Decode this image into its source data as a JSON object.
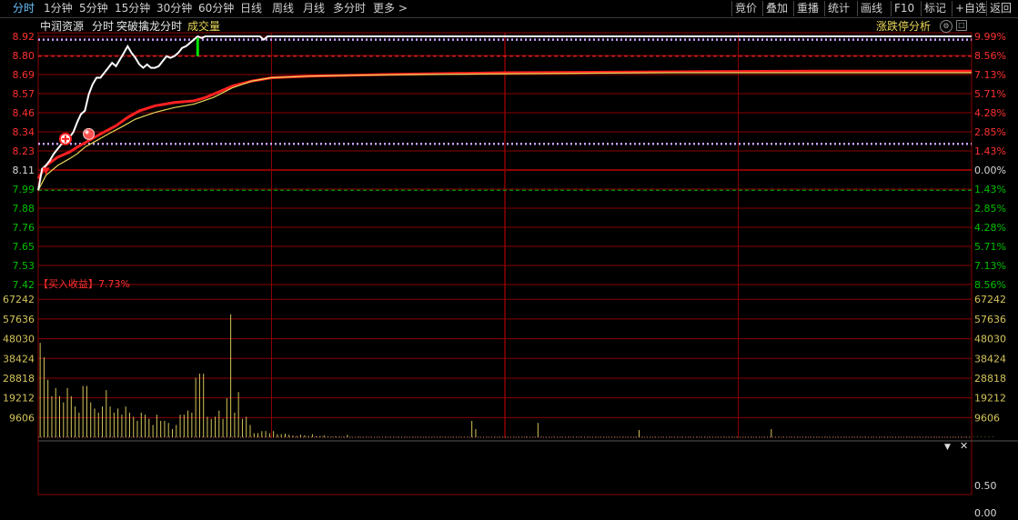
{
  "topbar": {
    "tabs": [
      "分时",
      "1分钟",
      "5分钟",
      "15分钟",
      "30分钟",
      "60分钟",
      "日线",
      "周线",
      "月线",
      "多分时",
      "更多 >"
    ],
    "active_tab": 0,
    "right_buttons": [
      "竟价",
      "叠加",
      "重播",
      "统计",
      "画线",
      "F10",
      "标记",
      "+自选",
      "返回"
    ]
  },
  "header": {
    "stock_name": "中润资源",
    "chart_mode": "分时",
    "indicator_name": "突破擒龙分时",
    "volume_label": "成交量",
    "limit_analysis": "涨跌停分析",
    "buy_profit_label": "【买入收益】",
    "buy_profit_value": "7.73%"
  },
  "colors": {
    "background": "#000000",
    "up": "#ff3030",
    "down": "#00c000",
    "price_line": "#ffffff",
    "avg_line": "#e8d858",
    "grid": "#8b0000",
    "volume_bar": "#d4c45a",
    "accent_label": "#6cc6ff"
  },
  "chart_data": {
    "type": "line",
    "price_axis": {
      "ticks": [
        "8.92",
        "8.80",
        "8.69",
        "8.57",
        "8.46",
        "8.34",
        "8.23",
        "8.11",
        "7.99",
        "7.88",
        "7.76",
        "7.65",
        "7.53",
        "7.42"
      ],
      "up_ticks": [
        "8.92",
        "8.80",
        "8.69",
        "8.57",
        "8.46",
        "8.34",
        "8.23"
      ],
      "base_tick": "8.11",
      "down_ticks": [
        "7.99",
        "7.88",
        "7.76",
        "7.65",
        "7.53",
        "7.42"
      ],
      "ylim": [
        7.42,
        8.92
      ],
      "pct_ticks": [
        "9.99%",
        "8.56%",
        "7.13%",
        "5.71%",
        "4.28%",
        "2.85%",
        "1.43%",
        "0.00%",
        "1.43%",
        "2.85%",
        "4.28%",
        "5.71%",
        "7.13%",
        "8.56%"
      ],
      "prev_close": 8.11
    },
    "reference_lines": [
      {
        "value": 8.9,
        "style": "dotted",
        "color": "#c8a0ff"
      },
      {
        "value": 8.8,
        "style": "dashed",
        "color": "#ff3030"
      },
      {
        "value": 8.27,
        "style": "dotted",
        "color": "#c8a0ff"
      },
      {
        "value": 7.99,
        "style": "dashed",
        "color": "#00c000"
      }
    ],
    "price_series": {
      "name": "",
      "points": [
        [
          0,
          7.99
        ],
        [
          1,
          8.12
        ],
        [
          2,
          8.14
        ],
        [
          3,
          8.17
        ],
        [
          4,
          8.21
        ],
        [
          5,
          8.24
        ],
        [
          6,
          8.27
        ],
        [
          7,
          8.29
        ],
        [
          8,
          8.31
        ],
        [
          9,
          8.34
        ],
        [
          10,
          8.4
        ],
        [
          11,
          8.45
        ],
        [
          12,
          8.47
        ],
        [
          13,
          8.57
        ],
        [
          14,
          8.63
        ],
        [
          15,
          8.67
        ],
        [
          16,
          8.67
        ],
        [
          17,
          8.7
        ],
        [
          18,
          8.73
        ],
        [
          19,
          8.76
        ],
        [
          20,
          8.74
        ],
        [
          21,
          8.78
        ],
        [
          22,
          8.82
        ],
        [
          23,
          8.86
        ],
        [
          24,
          8.82
        ],
        [
          25,
          8.79
        ],
        [
          26,
          8.75
        ],
        [
          27,
          8.73
        ],
        [
          28,
          8.75
        ],
        [
          29,
          8.73
        ],
        [
          30,
          8.73
        ],
        [
          31,
          8.74
        ],
        [
          32,
          8.77
        ],
        [
          33,
          8.8
        ],
        [
          34,
          8.79
        ],
        [
          35,
          8.8
        ],
        [
          36,
          8.82
        ],
        [
          37,
          8.85
        ],
        [
          38,
          8.86
        ],
        [
          39,
          8.88
        ],
        [
          40,
          8.9
        ],
        [
          41,
          8.92
        ],
        [
          42,
          8.91
        ],
        [
          43,
          8.92
        ],
        [
          45,
          8.92
        ],
        [
          50,
          8.92
        ],
        [
          55,
          8.92
        ],
        [
          57,
          8.92
        ],
        [
          58,
          8.9
        ],
        [
          59,
          8.92
        ],
        [
          61,
          8.92
        ],
        [
          65,
          8.92
        ],
        [
          100,
          8.92
        ],
        [
          150,
          8.92
        ],
        [
          200,
          8.92
        ],
        [
          240,
          8.92
        ]
      ]
    },
    "avg_series": {
      "name": "",
      "points": [
        [
          0,
          7.99
        ],
        [
          2,
          8.08
        ],
        [
          5,
          8.14
        ],
        [
          8,
          8.18
        ],
        [
          10,
          8.21
        ],
        [
          12,
          8.25
        ],
        [
          15,
          8.29
        ],
        [
          18,
          8.33
        ],
        [
          22,
          8.38
        ],
        [
          25,
          8.42
        ],
        [
          30,
          8.46
        ],
        [
          35,
          8.49
        ],
        [
          40,
          8.51
        ],
        [
          45,
          8.55
        ],
        [
          50,
          8.61
        ],
        [
          55,
          8.65
        ],
        [
          60,
          8.67
        ],
        [
          70,
          8.68
        ],
        [
          80,
          8.685
        ],
        [
          100,
          8.69
        ],
        [
          130,
          8.695
        ],
        [
          160,
          8.7
        ],
        [
          200,
          8.7
        ],
        [
          240,
          8.7
        ]
      ]
    },
    "indicator_series": {
      "name": "",
      "points": [
        [
          0,
          8.06
        ],
        [
          2,
          8.14
        ],
        [
          5,
          8.19
        ],
        [
          8,
          8.22
        ],
        [
          10,
          8.25
        ],
        [
          13,
          8.29
        ],
        [
          16,
          8.33
        ],
        [
          20,
          8.38
        ],
        [
          23,
          8.43
        ],
        [
          26,
          8.47
        ],
        [
          30,
          8.5
        ],
        [
          35,
          8.52
        ],
        [
          40,
          8.53
        ],
        [
          43,
          8.55
        ],
        [
          47,
          8.59
        ],
        [
          50,
          8.62
        ],
        [
          55,
          8.65
        ],
        [
          60,
          8.67
        ],
        [
          70,
          8.68
        ],
        [
          90,
          8.69
        ],
        [
          120,
          8.7
        ],
        [
          160,
          8.705
        ],
        [
          200,
          8.71
        ],
        [
          240,
          8.71
        ]
      ]
    },
    "markers": [
      {
        "x": 7,
        "y": 8.3,
        "kind": "buy-cross"
      },
      {
        "x": 13,
        "y": 8.33,
        "kind": "ball"
      },
      {
        "x": 2,
        "y": 8.11,
        "kind": "down-triangle"
      }
    ],
    "green_tick": {
      "x": 41,
      "value_top": 8.91,
      "value_bottom": 8.8
    },
    "volume_axis": {
      "ticks": [
        "67242",
        "57636",
        "48030",
        "38424",
        "28818",
        "19212",
        "9606"
      ],
      "ylim": [
        0,
        70000
      ]
    },
    "volume": [
      46000,
      39000,
      28000,
      20000,
      24000,
      20000,
      17000,
      24000,
      20000,
      15000,
      12000,
      25000,
      25000,
      17000,
      14000,
      12000,
      15000,
      23000,
      15000,
      12000,
      14000,
      11000,
      15000,
      12000,
      10000,
      8000,
      12000,
      11000,
      9000,
      6000,
      11000,
      8000,
      8000,
      7000,
      4000,
      6000,
      11000,
      11000,
      13000,
      12000,
      29000,
      31000,
      31000,
      10000,
      9000,
      10000,
      13000,
      9000,
      19000,
      60000,
      12000,
      22000,
      9000,
      10000,
      6000,
      2000,
      2000,
      3000,
      3000,
      2000,
      3000,
      1500,
      1500,
      1800,
      1200,
      800,
      600,
      1200,
      900,
      600,
      1500,
      500,
      600,
      900,
      400,
      300,
      500,
      300,
      300,
      1200,
      200,
      200,
      300,
      200,
      200,
      200,
      200,
      200,
      200,
      200,
      200,
      200,
      200,
      200,
      200,
      200,
      200,
      200,
      200,
      200,
      200,
      200,
      200,
      200,
      200,
      200,
      200,
      200,
      200,
      200,
      200,
      8000,
      4000,
      200,
      200,
      200,
      200,
      200,
      200,
      200,
      200,
      200,
      200,
      200,
      200,
      300,
      200,
      200,
      7000,
      200,
      200,
      200,
      200,
      200,
      200,
      200,
      200,
      200,
      200,
      200,
      200,
      200,
      200,
      200,
      200,
      200,
      200,
      200,
      200,
      200,
      200,
      200,
      200,
      200,
      3500,
      200,
      200,
      200,
      200,
      200,
      200,
      200,
      200,
      200,
      200,
      200,
      200,
      200,
      200,
      200,
      200,
      200,
      200,
      200,
      200,
      200,
      200,
      200,
      200,
      200,
      200,
      200,
      200,
      200,
      200,
      200,
      200,
      200,
      4000,
      200,
      200,
      200,
      200,
      200,
      200,
      200,
      200,
      200,
      200,
      200,
      200,
      200,
      200,
      200,
      200,
      200,
      200,
      200,
      200,
      200,
      200,
      200,
      200,
      200,
      200,
      200,
      200,
      200,
      200,
      200,
      200,
      200,
      200,
      200,
      200,
      200,
      200,
      200,
      200,
      200,
      200,
      200,
      200,
      200,
      200,
      200,
      200,
      200,
      200,
      200,
      200,
      200,
      200,
      200,
      200,
      200
    ],
    "sub_panel": {
      "ticks": [
        "0.50",
        "0.00"
      ]
    }
  }
}
